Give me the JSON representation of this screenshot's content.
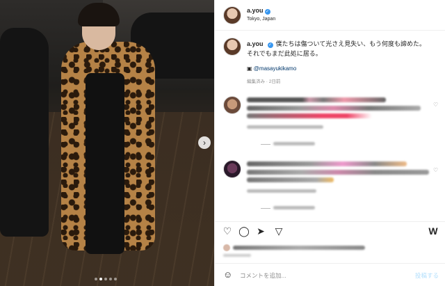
{
  "post": {
    "username": "a.you",
    "location": "Tokyo, Japan",
    "verified": true
  },
  "caption": {
    "username": "a.you",
    "line1": "僕たちは傷ついて光さえ見失い、もう何度も諦めた。",
    "line2": "それでもまだ此処に居る。",
    "mention_icon": "camera-icon",
    "mention": "@masayukikamo",
    "meta": "編集済み · 2日前"
  },
  "comments": {
    "count_visible": 2,
    "blurred": true
  },
  "photo": {
    "carousel_dots": 5,
    "active_dot": 2,
    "next_icon": "›"
  },
  "actions": {
    "like_icon": "heart-icon",
    "comment_icon": "comment-icon",
    "share_icon": "send-icon",
    "save_icon": "bookmark-icon"
  },
  "comment_bar": {
    "emoji_icon": "smiley-icon",
    "placeholder": "コメントを追加...",
    "post_label": "投稿する"
  },
  "colors": {
    "link": "#00376b",
    "muted": "#8e8e8e",
    "verified": "#3897f0",
    "post_disabled": "#b2dffc"
  }
}
